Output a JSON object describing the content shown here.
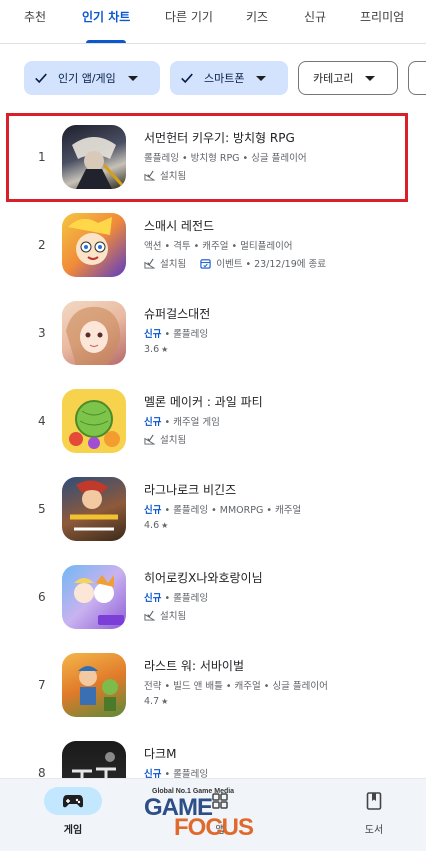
{
  "tabs": [
    {
      "label": "추천",
      "active": false
    },
    {
      "label": "인기 차트",
      "active": true
    },
    {
      "label": "다른 기기",
      "active": false
    },
    {
      "label": "키즈",
      "active": false
    },
    {
      "label": "신규",
      "active": false
    },
    {
      "label": "프리미엄",
      "active": false
    }
  ],
  "chips": [
    {
      "label": "인기 앱/게임",
      "selected": true
    },
    {
      "label": "스마트폰",
      "selected": true
    },
    {
      "label": "카테고리",
      "selected": false
    }
  ],
  "apps": [
    {
      "rank": "1",
      "name": "서먼헌터 키우기: 방치형 RPG",
      "is_new": false,
      "tags": "롤플레잉 • 방치형 RPG • 싱글 플레이어",
      "installed": "설치됨",
      "rating": null,
      "event": null
    },
    {
      "rank": "2",
      "name": "스매시 레전드",
      "is_new": false,
      "tags": "액션 • 격투 • 캐주얼 • 멀티플레이어",
      "installed": "설치됨",
      "rating": null,
      "event": "이벤트 • 23/12/19에 종료"
    },
    {
      "rank": "3",
      "name": "슈퍼걸스대전",
      "is_new": true,
      "new_label": "신규",
      "tags": "롤플레잉",
      "installed": null,
      "rating": "3.6",
      "event": null
    },
    {
      "rank": "4",
      "name": "멜론 메이커 : 과일 파티",
      "is_new": true,
      "new_label": "신규",
      "tags": "캐주얼 게임",
      "installed": "설치됨",
      "rating": null,
      "event": null
    },
    {
      "rank": "5",
      "name": "라그나로크 비긴즈",
      "is_new": true,
      "new_label": "신규",
      "tags": "롤플레잉 • MMORPG • 캐주얼",
      "installed": null,
      "rating": "4.6",
      "event": null
    },
    {
      "rank": "6",
      "name": "히어로킹X나와호랑이님",
      "is_new": true,
      "new_label": "신규",
      "tags": "롤플레잉",
      "installed": "설치됨",
      "rating": null,
      "event": null
    },
    {
      "rank": "7",
      "name": "라스트 워: 서바이벌",
      "is_new": false,
      "tags": "전략 • 빌드 앤 배틀 • 캐주얼 • 싱글 플레이어",
      "installed": null,
      "rating": "4.7",
      "event": null
    },
    {
      "rank": "8",
      "name": "다크M",
      "is_new": true,
      "new_label": "신규",
      "tags": "롤플레잉",
      "installed": null,
      "rating": null,
      "event": null
    }
  ],
  "bottom_nav": [
    {
      "label": "게임",
      "active": true,
      "icon": "gamepad-icon"
    },
    {
      "label": "앱",
      "active": false,
      "icon": "apps-icon"
    },
    {
      "label": "도서",
      "active": false,
      "icon": "book-icon"
    }
  ],
  "watermark": {
    "tagline": "Global No.1 Game Media",
    "word1": "GAME",
    "word2": "FOCUS"
  },
  "colors": {
    "accent": "#0b57d0",
    "chip_selected": "#d3e3fd",
    "highlight": "#d9202a",
    "nav_active": "#c2e7ff"
  }
}
